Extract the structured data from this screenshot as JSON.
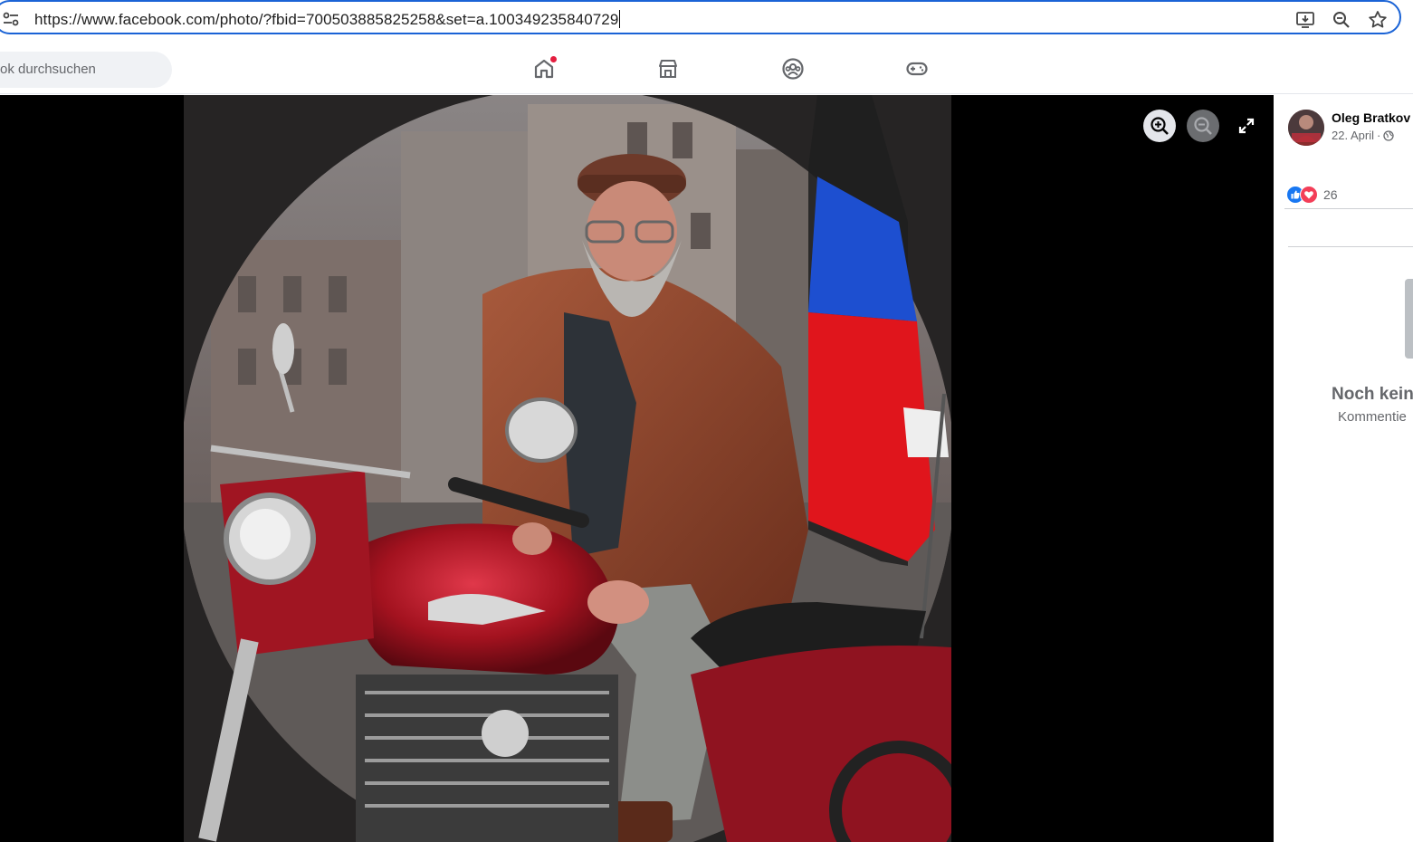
{
  "browser": {
    "url": "https://www.facebook.com/photo/?fbid=700503885825258&set=a.100349235840729",
    "icons": [
      "site-info-icon",
      "install-app-icon",
      "zoom-icon",
      "bookmark-star-icon"
    ]
  },
  "fb_nav": {
    "search_placeholder": "ok durchsuchen",
    "tabs": [
      {
        "name": "home",
        "icon": "home-icon",
        "has_notification": true
      },
      {
        "name": "marketplace",
        "icon": "marketplace-icon"
      },
      {
        "name": "groups",
        "icon": "groups-icon"
      },
      {
        "name": "gaming",
        "icon": "gaming-icon"
      }
    ]
  },
  "viewer": {
    "controls": [
      "zoom-in-icon",
      "zoom-out-icon",
      "fullscreen-icon"
    ],
    "photo_description_icon": "motorcycle-photo"
  },
  "post": {
    "author": "Oleg Bratkov",
    "date": "22. April",
    "date_separator": "·",
    "privacy_icon": "globe-icon",
    "reaction_count": "26",
    "reactions": [
      "like",
      "love"
    ],
    "no_comments_title": "Noch kein",
    "no_comments_subtitle": "Kommentie"
  },
  "colors": {
    "facebook_blue": "#1877f2",
    "love_red": "#f33e58",
    "omnibox_border": "#1a63d6",
    "notification_red": "#e41e3f"
  }
}
